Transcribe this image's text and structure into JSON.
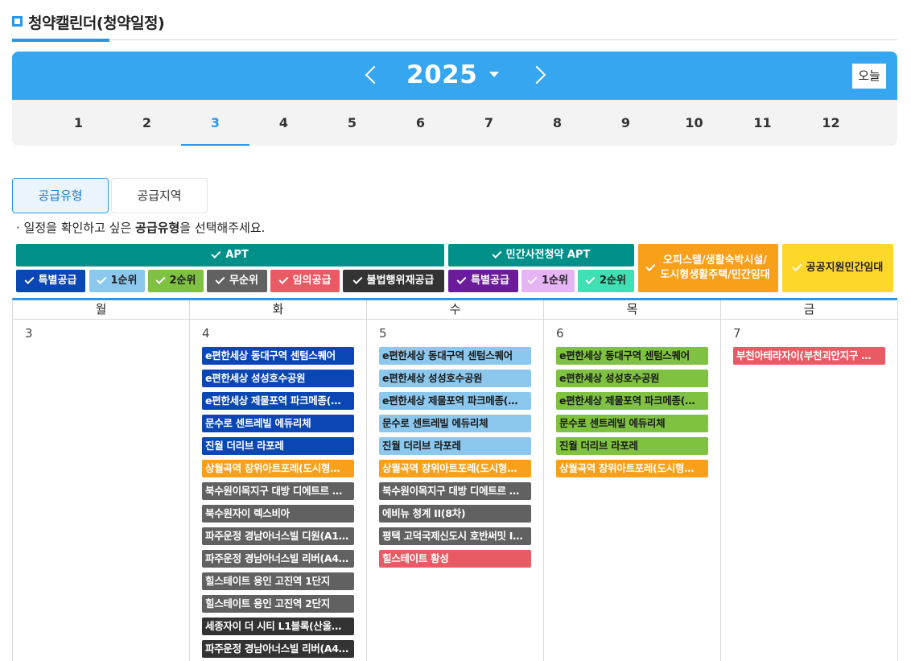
{
  "page_title": "청약캘린더(청약일정)",
  "year": "2025",
  "today_label": "오늘",
  "months": [
    "1",
    "2",
    "3",
    "4",
    "5",
    "6",
    "7",
    "8",
    "9",
    "10",
    "11",
    "12"
  ],
  "active_month": "3",
  "tabs": {
    "supply_type": "공급유형",
    "supply_region": "공급지역"
  },
  "note": {
    "prefix": "· 일정을 확인하고 싶은 ",
    "bold": "공급유형",
    "suffix": "을 선택해주세요."
  },
  "filters": {
    "apt": "APT",
    "private_pre": "민간사전청약 APT",
    "officetel": "오피스텔/생활숙박시설/\n도시형생활주택/민간임대",
    "public_support": "공공지원민간임대",
    "apt_special": "특별공급",
    "apt_first": "1순위",
    "apt_second": "2순위",
    "apt_unranked": "무순위",
    "apt_arbitrary": "임의공급",
    "apt_illegal": "불법행위재공급",
    "pre_special": "특별공급",
    "pre_first": "1순위",
    "pre_second": "2순위"
  },
  "colors": {
    "accent": "#2a98e8",
    "apt": "#00908a",
    "special": "#0a46b4",
    "first": "#8cc8ee",
    "second": "#7fc241",
    "unranked": "#616161",
    "arbitrary": "#e85b64",
    "illegal": "#333333",
    "pre_special": "#6a1c9a",
    "pre_first": "#e6b3f5",
    "pre_second": "#3fe0b4",
    "officetel": "#f9a01b",
    "public_support": "#fdd82a"
  },
  "weekdays": [
    "월",
    "화",
    "수",
    "목",
    "금"
  ],
  "days": [
    {
      "date": "3",
      "events": []
    },
    {
      "date": "4",
      "events": [
        {
          "name": "e편한세상 동대구역 센텀스퀘어",
          "cat": "special"
        },
        {
          "name": "e편한세상 성성호수공원",
          "cat": "special"
        },
        {
          "name": "e편한세상 제물포역 파크메종(…",
          "cat": "special"
        },
        {
          "name": "문수로 센트레빌 에듀리체",
          "cat": "special"
        },
        {
          "name": "진월 더리브 라포레",
          "cat": "special"
        },
        {
          "name": "상월곡역 장위아트포레(도시형…",
          "cat": "officetel"
        },
        {
          "name": "북수원이목지구 대방 디에트르 …",
          "cat": "unranked"
        },
        {
          "name": "북수원자이 렉스비아",
          "cat": "unranked"
        },
        {
          "name": "파주운정 경남아너스빌 디원(A1…",
          "cat": "unranked"
        },
        {
          "name": "파주운정 경남아너스빌 리버(A4…",
          "cat": "unranked"
        },
        {
          "name": "힐스테이트 용인 고진역 1단지",
          "cat": "unranked"
        },
        {
          "name": "힐스테이트 용인 고진역 2단지",
          "cat": "unranked"
        },
        {
          "name": "세종자이 더 시티 L1블록(산울…",
          "cat": "illegal"
        },
        {
          "name": "파주운정 경남아너스빌 리버(A4…",
          "cat": "illegal"
        }
      ]
    },
    {
      "date": "5",
      "events": [
        {
          "name": "e편한세상 동대구역 센텀스퀘어",
          "cat": "first"
        },
        {
          "name": "e편한세상 성성호수공원",
          "cat": "first"
        },
        {
          "name": "e편한세상 제물포역 파크메종(…",
          "cat": "first"
        },
        {
          "name": "문수로 센트레빌 에듀리체",
          "cat": "first"
        },
        {
          "name": "진월 더리브 라포레",
          "cat": "first"
        },
        {
          "name": "상월곡역 장위아트포레(도시형…",
          "cat": "officetel"
        },
        {
          "name": "북수원이목지구 대방 디에트르 …",
          "cat": "unranked"
        },
        {
          "name": "에비뉴 청계 II(8차)",
          "cat": "unranked"
        },
        {
          "name": "평택 고덕국제신도시 호반써밋 I…",
          "cat": "unranked"
        },
        {
          "name": "힐스테이트 황성",
          "cat": "arbitrary"
        }
      ]
    },
    {
      "date": "6",
      "events": [
        {
          "name": "e편한세상 동대구역 센텀스퀘어",
          "cat": "second"
        },
        {
          "name": "e편한세상 성성호수공원",
          "cat": "second"
        },
        {
          "name": "e편한세상 제물포역 파크메종(…",
          "cat": "second"
        },
        {
          "name": "문수로 센트레빌 에듀리체",
          "cat": "second"
        },
        {
          "name": "진월 더리브 라포레",
          "cat": "second"
        },
        {
          "name": "상월곡역 장위아트포레(도시형…",
          "cat": "officetel"
        }
      ]
    },
    {
      "date": "7",
      "events": [
        {
          "name": "부천아테라자이(부천괴안지구 …",
          "cat": "arbitrary"
        }
      ]
    }
  ]
}
